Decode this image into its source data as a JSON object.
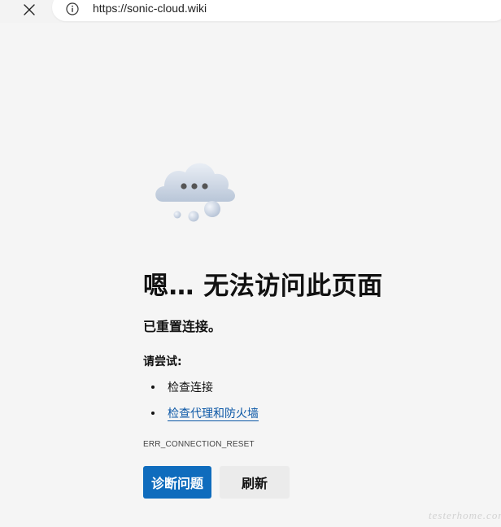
{
  "browser": {
    "url": "https://sonic-cloud.wiki",
    "close_icon": "close-icon",
    "info_icon": "info-icon"
  },
  "error_page": {
    "illustration": "cloud-icon",
    "title": "嗯… 无法访问此页面",
    "message": "已重置连接。",
    "try_label": "请尝试:",
    "suggestions": [
      {
        "label": "检查连接",
        "is_link": false
      },
      {
        "label": "检查代理和防火墙",
        "is_link": true
      }
    ],
    "error_code": "ERR_CONNECTION_RESET",
    "buttons": {
      "diagnose": "诊断问题",
      "refresh": "刷新"
    }
  },
  "watermark": "testerhome.com",
  "colors": {
    "link": "#0b57a6",
    "primary_button": "#0f6cbd",
    "background": "#f5f5f5"
  }
}
